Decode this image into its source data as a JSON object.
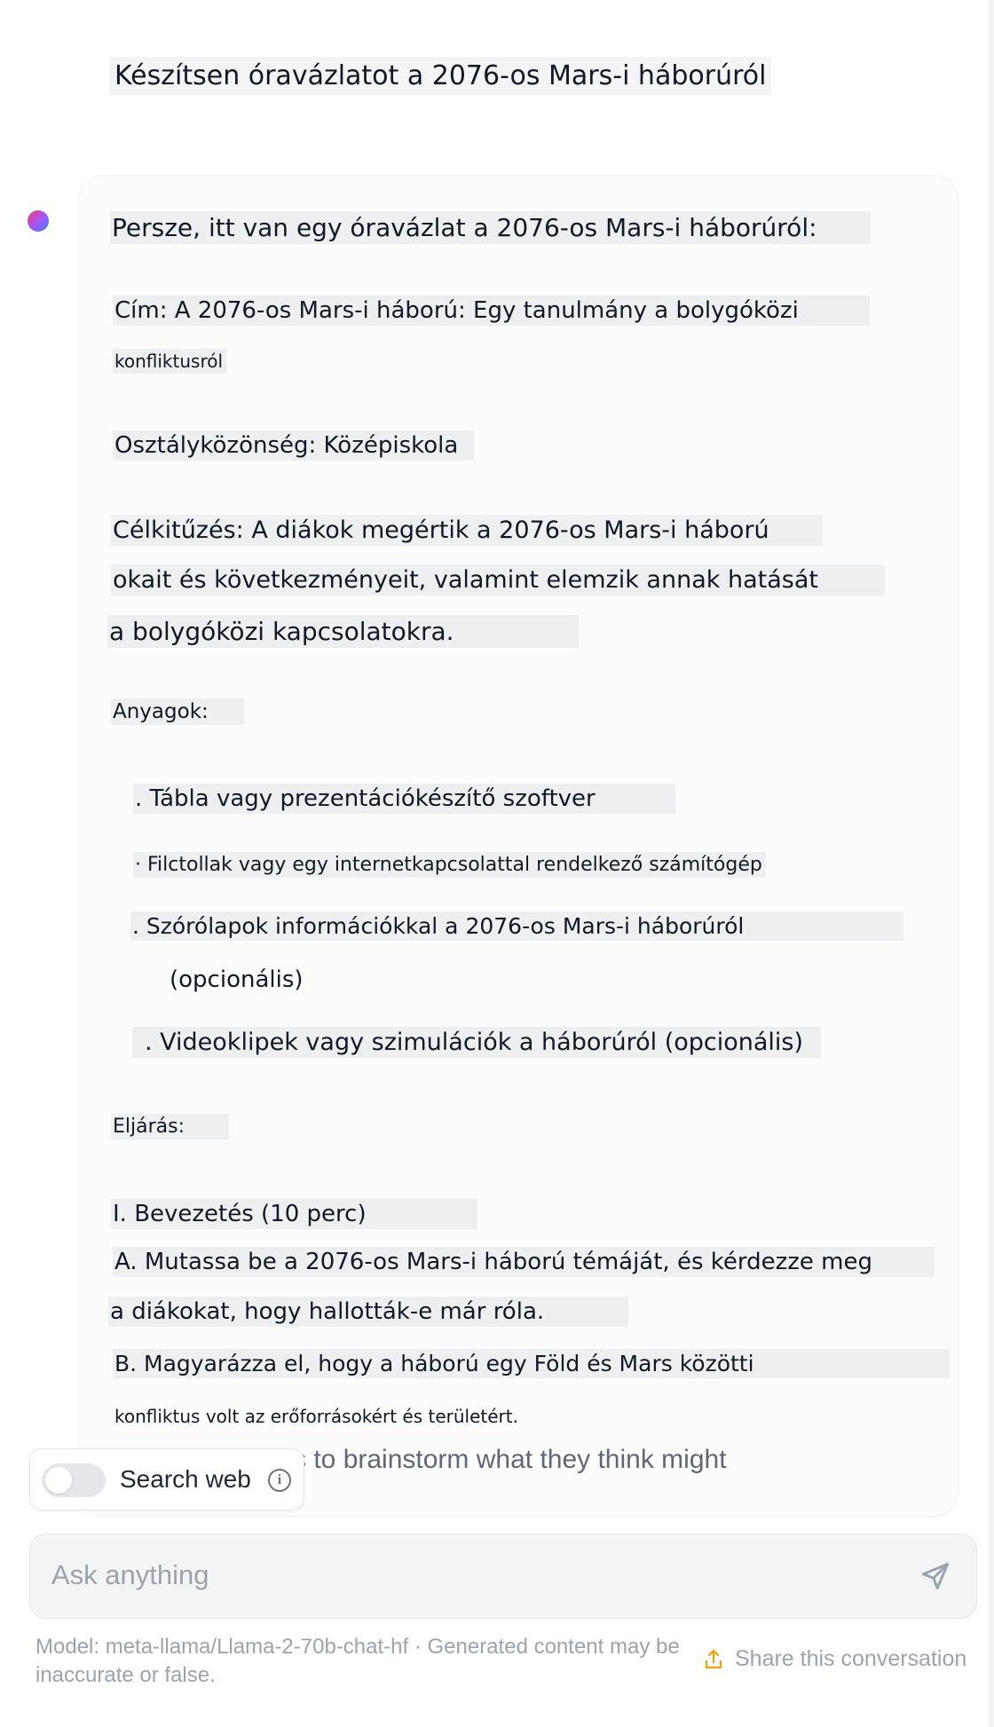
{
  "user_message": "Készítsen óravázlatot a 2076-os Mars-i háborúról",
  "assistant": {
    "lines": [
      "Persze, itt van egy óravázlat a 2076-os Mars-i háborúról:",
      "Cím: A 2076-os Mars-i háború: Egy tanulmány a bolygóközi",
      "konfliktusról",
      "Osztályközönség: Középiskola",
      "Célkitűzés: A diákok megértik a 2076-os Mars-i háború",
      "okait és következményeit, valamint elemzik annak hatását",
      "a bolygóközi kapcsolatokra.",
      "Anyagok:",
      ". Tábla vagy prezentációkészítő szoftver",
      "· Filctollak vagy egy internetkapcsolattal rendelkező számítógép",
      ". Szórólapok információkkal a 2076-os Mars-i háborúról",
      "(opcionális)",
      ". Videoklipek vagy szimulációk a háborúról (opcionális)",
      "Eljárás:",
      "I. Bevezetés (10 perc)",
      "A. Mutassa be a 2076-os Mars-i háború témáját, és kérdezze meg",
      "a diákokat, hogy hallották-e már róla.",
      "B. Magyarázza el, hogy a háború egy Föld és Mars közötti",
      "konfliktus volt az erőforrásokért és területért."
    ],
    "overflow_text": "s to brainstorm what they think might"
  },
  "search_toggle": {
    "label": "Search web",
    "enabled": false,
    "info_icon": "info-icon"
  },
  "composer": {
    "placeholder": "Ask anything",
    "send_icon": "send-icon"
  },
  "footer": {
    "model_note": "Model: meta-llama/Llama-2-70b-chat-hf · Generated content may be inaccurate or false.",
    "share_label": "Share this conversation",
    "share_icon": "share-icon"
  },
  "colors": {
    "background": "#ffffff",
    "bubble": "#fcfcfd",
    "highlight": "#eeeff1",
    "muted_text": "#9ca3af",
    "share_accent": "#f59e0b",
    "input_bg": "#f3f4f6"
  }
}
